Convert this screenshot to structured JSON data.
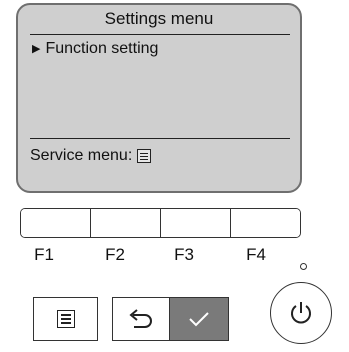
{
  "screen": {
    "title": "Settings menu",
    "selected_item_marker": "▶",
    "menu_items": [
      "Function setting"
    ],
    "service_label": "Service menu:"
  },
  "function_keys": [
    "F1",
    "F2",
    "F3",
    "F4"
  ],
  "colors": {
    "screen_bg": "#cfcfcf",
    "check_button_bg": "#7a7a7a"
  },
  "icons": {
    "menu_button": "menu-list-icon",
    "back_button": "return-arrow-icon",
    "check_button": "checkmark-icon",
    "power_button": "power-icon"
  }
}
